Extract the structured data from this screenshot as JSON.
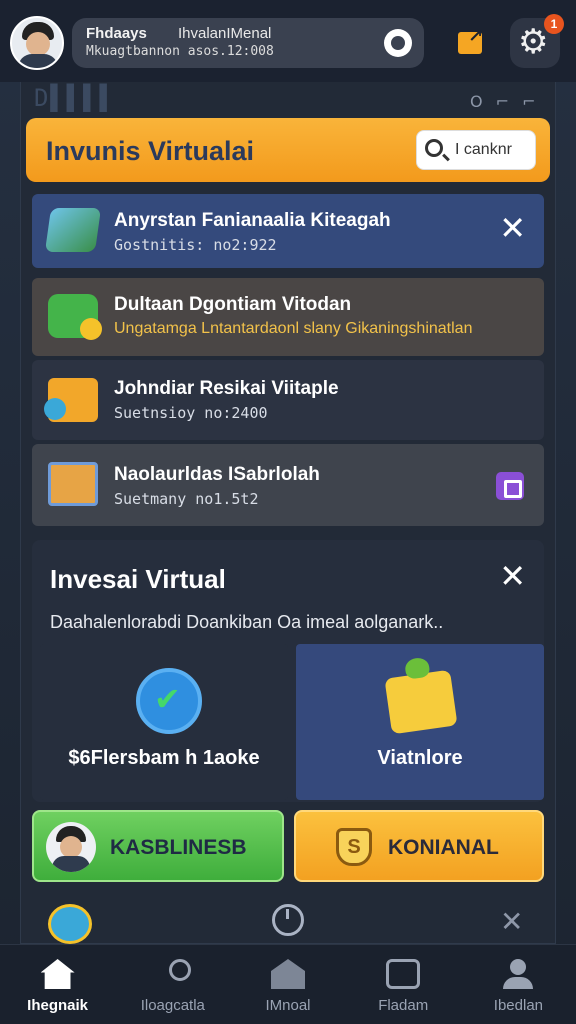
{
  "header": {
    "user_name": "Fhdaays",
    "user_tag": "IhvalanIMenal",
    "user_info": "Mkuagtbannon asos.12:008",
    "badge_count": "1"
  },
  "background": {
    "glyph_left": "D▌▌▌▌",
    "glyph_right": "O ⌐ ⌐"
  },
  "banner": {
    "title": "Invunis Virtualai",
    "search_placeholder": "I canknr"
  },
  "list": [
    {
      "title": "Anyrstan Fanianaalia Kiteagah",
      "subtitle": "Gostnitis: no2:922"
    },
    {
      "title": "Dultaan Dgontiam Vitodan",
      "subtitle": "Ungatamga Lntantardaonl slany Gikaningshinatlan"
    },
    {
      "title": "Johndiar Resikai Viitaple",
      "subtitle": "Suetnsioy no:2400"
    },
    {
      "title": "Naolaurldas ISabrlolah",
      "subtitle": "Suetmany no1.5t2"
    }
  ],
  "invest_panel": {
    "title": "Invesai Virtual",
    "description": "Daahalenlorabdi Doankiban Oa imeal aolganark..",
    "options": [
      {
        "label": "$6Flersbam h 1aoke"
      },
      {
        "label": "Viatnlore"
      }
    ]
  },
  "actions": {
    "green_label": "KASBLINESB",
    "orange_label": "KONIANAL",
    "orange_icon_glyph": "S"
  },
  "nav": [
    {
      "label": "Ihegnaik"
    },
    {
      "label": "Iloagcatla"
    },
    {
      "label": "IMnoal"
    },
    {
      "label": "Fladam"
    },
    {
      "label": "Ibedlan"
    }
  ],
  "colors": {
    "accent_orange": "#f5a623",
    "accent_green": "#4cbf45",
    "row_blue": "#344a7c",
    "background": "#1f2734"
  },
  "icons": [
    "share-icon",
    "gear-icon",
    "eye-icon",
    "search-icon",
    "close-icon",
    "home-icon",
    "key-icon",
    "store-icon",
    "chat-icon",
    "user-icon"
  ]
}
